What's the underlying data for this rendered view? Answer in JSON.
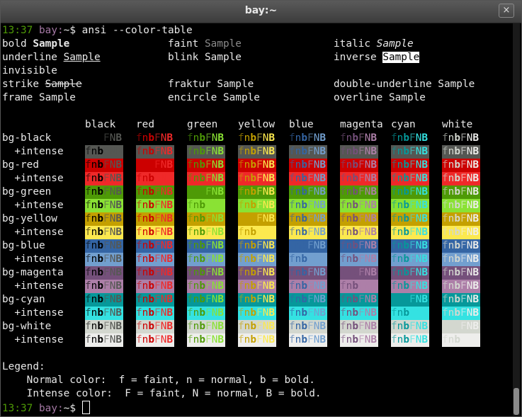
{
  "window": {
    "title": "bay:~",
    "close_icon": "×"
  },
  "prompt": {
    "time": "13:37",
    "host": "bay:",
    "path": "~",
    "sym": "$",
    "command": " ansi --color-table"
  },
  "styles": {
    "col1": [
      {
        "label": "bold ",
        "sample": "Sample"
      },
      {
        "label": "underline ",
        "sample": "Sample"
      },
      {
        "label": "invisible",
        "sample": ""
      },
      {
        "label": "strike ",
        "sample": "Sample"
      },
      {
        "label": "frame ",
        "sample": "Sample"
      }
    ],
    "col2": [
      {
        "label": "faint ",
        "sample": "Sample"
      },
      {
        "label": "blink ",
        "sample": "Sample"
      },
      {
        "label": "fraktur ",
        "sample": "Sample"
      },
      {
        "label": "encircle ",
        "sample": "Sample"
      }
    ],
    "col3": [
      {
        "label": "italic ",
        "sample": "Sample"
      },
      {
        "label": "inverse ",
        "sample": "Sample"
      },
      {
        "label": "double-underline ",
        "sample": "Sample"
      },
      {
        "label": "overline ",
        "sample": "Sample"
      }
    ]
  },
  "table": {
    "headers": [
      "black",
      "red",
      "green",
      "yellow",
      "blue",
      "magenta",
      "cyan",
      "white"
    ],
    "rows": [
      "bg-black",
      "  +intense",
      "bg-red",
      "  +intense",
      "bg-green",
      "  +intense",
      "bg-yellow",
      "  +intense",
      "bg-blue",
      "  +intense",
      "bg-magenta",
      "  +intense",
      "bg-cyan",
      "  +intense",
      "bg-white",
      "  +intense"
    ],
    "sample": "fnbFNB",
    "colors": {
      "normal": [
        "#000000",
        "#cc0000",
        "#4e9a06",
        "#c4a000",
        "#3465a4",
        "#75507b",
        "#06989a",
        "#d3d7cf"
      ],
      "intense": [
        "#555753",
        "#ef2929",
        "#8ae234",
        "#fce94f",
        "#729fcf",
        "#ad7fa8",
        "#34e2e2",
        "#eeeeec"
      ]
    }
  },
  "legend": {
    "title": "Legend:",
    "line1": "    Normal color:  f = faint, n = normal, b = bold.",
    "line2": "    Intense color:  F = faint, N = normal, B = bold."
  },
  "prompt2": {
    "time": "13:37",
    "host": "bay:",
    "path": "~",
    "sym": "$ "
  }
}
